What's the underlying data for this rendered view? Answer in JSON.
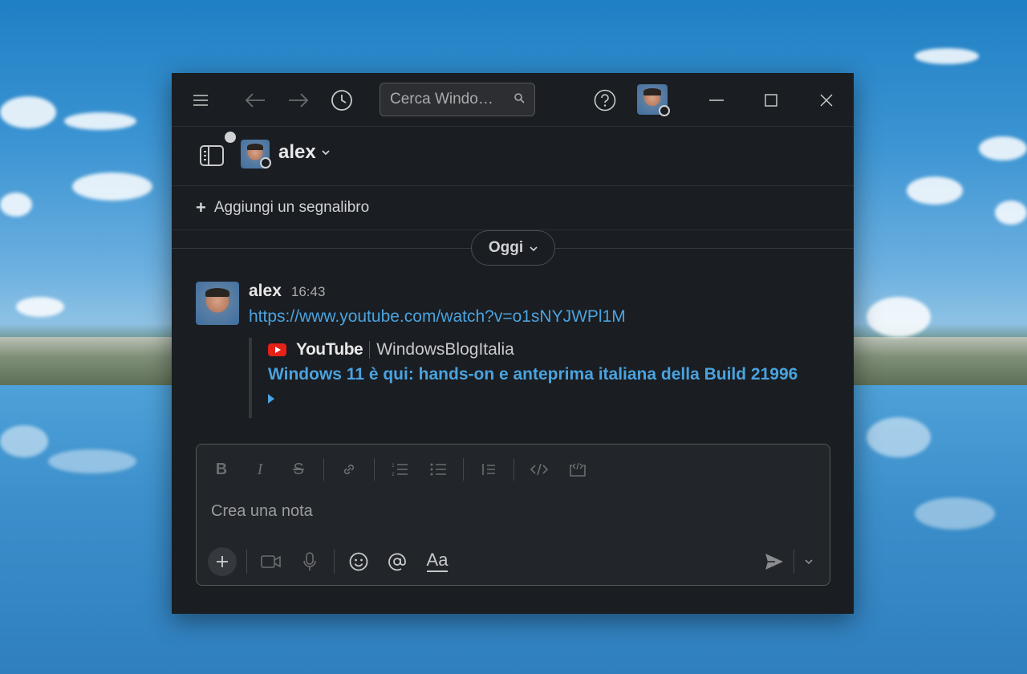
{
  "titlebar": {
    "search_placeholder": "Cerca Windo…",
    "icons": [
      "menu-icon",
      "back-arrow-icon",
      "forward-arrow-icon",
      "history-icon",
      "search-icon",
      "help-icon",
      "minimize-icon",
      "maximize-icon",
      "close-icon"
    ]
  },
  "header": {
    "workspace_name": "alex"
  },
  "bookmarks": {
    "add_label": "Aggiungi un segnalibro"
  },
  "divider": {
    "label": "Oggi"
  },
  "message": {
    "author": "alex",
    "time": "16:43",
    "link": "https://www.youtube.com/watch?v=o1sNYJWPl1M",
    "attachment": {
      "service": "YouTube",
      "channel": "WindowsBlogItalia",
      "title": "Windows 11 è qui: hands-on e anteprima italiana della Build 21996"
    }
  },
  "composer": {
    "placeholder": "Crea una nota",
    "format_label": "Aa"
  },
  "colors": {
    "window_bg": "#1a1d21",
    "link": "#4aa3df",
    "youtube_red": "#e62117"
  }
}
